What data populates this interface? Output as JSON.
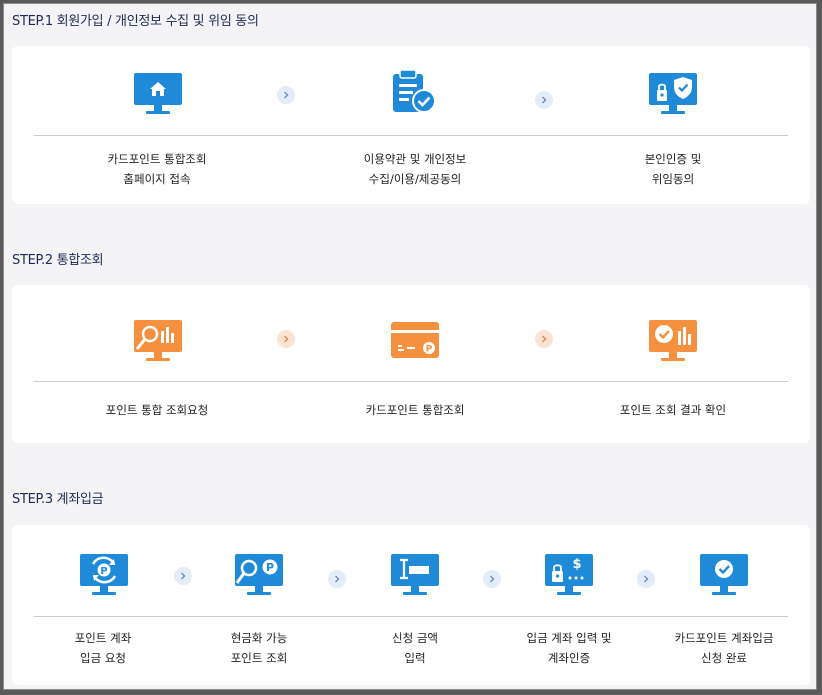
{
  "step1": {
    "title": "STEP.1 회원가입 / 개인정보 수집 및 위임 동의",
    "items": [
      {
        "line1": "카드포인트 통합조회",
        "line2": "홈페이지 접속",
        "icon": "home-monitor-icon"
      },
      {
        "line1": "이용약관 및 개인정보",
        "line2": "수집/이용/제공동의",
        "icon": "clipboard-check-icon"
      },
      {
        "line1": "본인인증 및",
        "line2": "위임동의",
        "icon": "shield-lock-monitor-icon"
      }
    ]
  },
  "step2": {
    "title": "STEP.2 통합조회",
    "items": [
      {
        "line1": "포인트 통합 조회요청",
        "icon": "search-chart-monitor-icon"
      },
      {
        "line1": "카드포인트 통합조회",
        "icon": "point-card-icon"
      },
      {
        "line1": "포인트 조회 결과 확인",
        "icon": "check-chart-monitor-icon"
      }
    ]
  },
  "step3": {
    "title": "STEP.3 계좌입금",
    "items": [
      {
        "line1": "포인트 계좌",
        "line2": "입금 요청",
        "icon": "point-refresh-monitor-icon"
      },
      {
        "line1": "현금화 가능",
        "line2": "포인트 조회",
        "icon": "point-search-monitor-icon"
      },
      {
        "line1": "신청 금액",
        "line2": "입력",
        "icon": "amount-input-monitor-icon"
      },
      {
        "line1": "입금 계좌 입력 및",
        "line2": "계좌인증",
        "icon": "account-lock-monitor-icon"
      },
      {
        "line1": "카드포인트 계좌입금",
        "line2": "신청 완료",
        "icon": "check-monitor-icon"
      }
    ]
  },
  "colors": {
    "blue": "#1f8ad8",
    "orange": "#f5913e",
    "navy": "#1e2a55"
  }
}
